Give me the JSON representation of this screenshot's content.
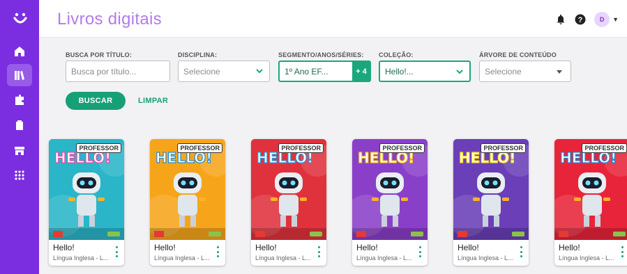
{
  "header": {
    "title": "Livros digitais",
    "avatar_initial": "D"
  },
  "sidebar": {
    "items": [
      {
        "icon": "home-icon",
        "active": false
      },
      {
        "icon": "library-icon",
        "active": true
      },
      {
        "icon": "puzzle-icon",
        "active": false
      },
      {
        "icon": "clipboard-icon",
        "active": false
      },
      {
        "icon": "store-icon",
        "active": false
      },
      {
        "icon": "apps-grid-icon",
        "active": false
      }
    ]
  },
  "filters": {
    "title_label": "BUSCA POR TÍTULO:",
    "title_placeholder": "Busca por título...",
    "discipline_label": "DISCIPLINA:",
    "discipline_value": "Selecione",
    "segment_label": "SEGMENTO/ANOS/SÉRIES:",
    "segment_value": "1º Ano EF...",
    "segment_more": "+ 4",
    "collection_label": "COLEÇÃO:",
    "collection_value": "Hello!...",
    "tree_label": "ÁRVORE DE CONTEÚDO",
    "tree_value": "Selecione",
    "search_button": "BUSCAR",
    "clear_button": "LIMPAR"
  },
  "books": [
    {
      "badge": "PROFESSOR",
      "title": "Hello!",
      "subtitle": "Língua Inglesa - L...",
      "cover_color": "#2ab5c8",
      "cover_accent": "#e74aa8"
    },
    {
      "badge": "PROFESSOR",
      "title": "Hello!",
      "subtitle": "Língua Inglesa - L...",
      "cover_color": "#f6a51a",
      "cover_accent": "#1e8bd6"
    },
    {
      "badge": "PROFESSOR",
      "title": "Hello!",
      "subtitle": "Língua Inglesa - L...",
      "cover_color": "#e0323c",
      "cover_accent": "#2b9be0"
    },
    {
      "badge": "PROFESSOR",
      "title": "Hello!",
      "subtitle": "Língua Inglesa - L...",
      "cover_color": "#8a3fc9",
      "cover_accent": "#f6c21a"
    },
    {
      "badge": "PROFESSOR",
      "title": "Hello!",
      "subtitle": "Língua Inglesa - L...",
      "cover_color": "#6a3fb8",
      "cover_accent": "#f2d21a"
    },
    {
      "badge": "PROFESSOR",
      "title": "Hello!",
      "subtitle": "Língua Inglesa - L...",
      "cover_color": "#e8243a",
      "cover_accent": "#1e8bd6"
    }
  ],
  "colors": {
    "brand": "#7b2ee0",
    "accent": "#17a078",
    "title": "#b37be8"
  }
}
